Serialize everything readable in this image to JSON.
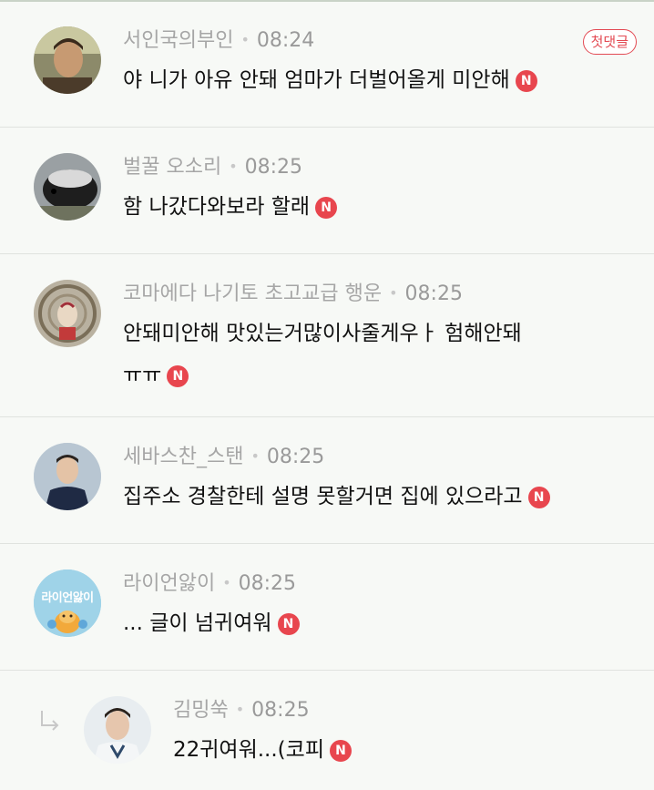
{
  "comments": [
    {
      "author": "서인국의부인",
      "time": "08:24",
      "text": "야 니가 아유 안돼 엄마가 더벌어올게 미안해",
      "badge": "N",
      "first_badge": "첫댓글"
    },
    {
      "author": "벌꿀 오소리",
      "time": "08:25",
      "text": "함 나갔다와보라 할래",
      "badge": "N"
    },
    {
      "author": "코마에다 나기토 초고교급 행운",
      "time": "08:25",
      "text_line1": "안돼미안해 맛있는거많이사줄게우ㅏ 험해안돼",
      "text_line2": "ㅠㅠ",
      "badge": "N"
    },
    {
      "author": "세바스찬_스탠",
      "time": "08:25",
      "text": "집주소 경찰한테 설명 못할거면 집에 있으라고",
      "badge": "N"
    },
    {
      "author": "라이언앓이",
      "time": "08:25",
      "text": "... 글이 넘귀여워",
      "badge": "N",
      "avatar_text": "라이언앓이"
    },
    {
      "author": "김밍쑥",
      "time": "08:25",
      "text": "22귀여워...(코피",
      "badge": "N",
      "is_reply": true
    }
  ],
  "colors": {
    "badge_red": "#e8464e",
    "background": "#f7f9f6",
    "meta_gray": "#a6a6a6"
  },
  "icons": {
    "reply": "reply-arrow-icon",
    "new": "new-badge-icon"
  }
}
